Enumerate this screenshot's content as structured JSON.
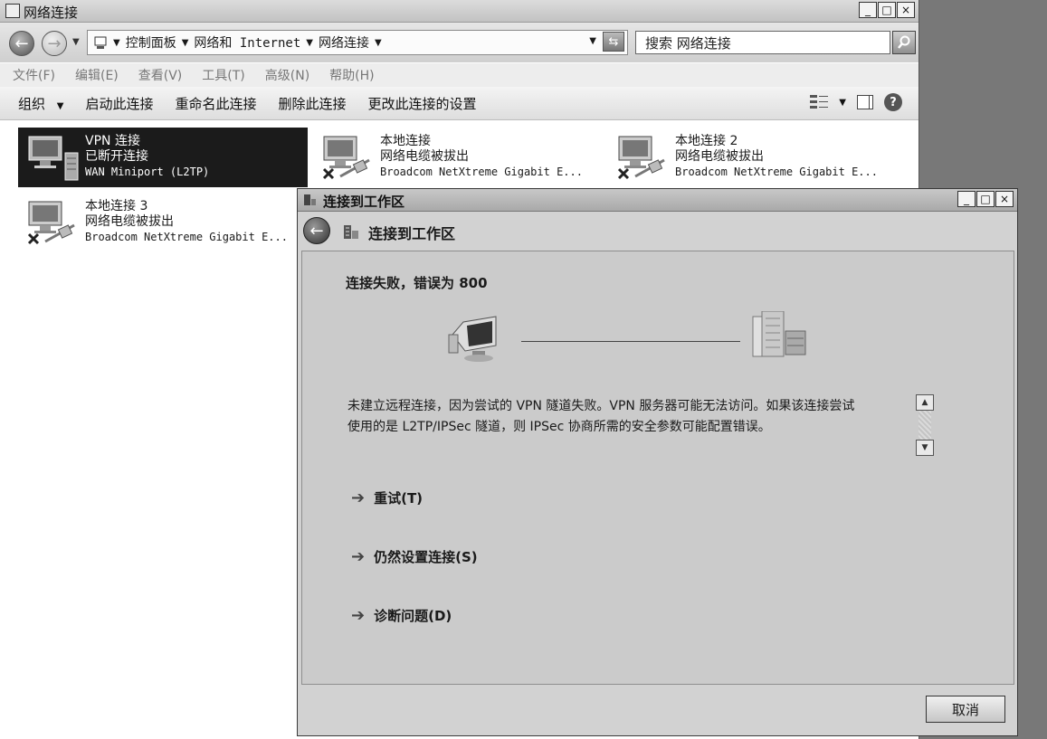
{
  "explorer": {
    "title": "网络连接",
    "window_buttons": [
      "_",
      "□",
      "×"
    ],
    "address": {
      "crumbs": [
        "控制面板",
        "网络和 Internet",
        "网络连接"
      ],
      "search_placeholder": "搜索 网络连接"
    },
    "menu": [
      "文件(F)",
      "编辑(E)",
      "查看(V)",
      "工具(T)",
      "高级(N)",
      "帮助(H)"
    ],
    "commands": {
      "organize": "组织",
      "start": "启动此连接",
      "rename": "重命名此连接",
      "delete": "删除此连接",
      "change_settings": "更改此连接的设置",
      "help": "?"
    },
    "connections": [
      {
        "name": "VPN 连接",
        "status": "已断开连接",
        "device": "WAN Miniport (L2TP)",
        "icon": "vpn-server-icon"
      },
      {
        "name": "本地连接",
        "status": "网络电缆被拔出",
        "device": "Broadcom NetXtreme Gigabit E...",
        "icon": "lan-disconnected-icon"
      },
      {
        "name": "本地连接 2",
        "status": "网络电缆被拔出",
        "device": "Broadcom NetXtreme Gigabit E...",
        "icon": "lan-disconnected-icon"
      },
      {
        "name": "本地连接 3",
        "status": "网络电缆被拔出",
        "device": "Broadcom NetXtreme Gigabit E...",
        "icon": "lan-disconnected-icon"
      }
    ]
  },
  "dialog": {
    "title": "连接到工作区",
    "header": "连接到工作区",
    "error_title": "连接失败，错误为 800",
    "message_lines": [
      "未建立远程连接，因为尝试的 VPN 隧道失败。VPN 服务器可能无法访问。如果该连接尝试",
      "使用的是 L2TP/IPSec 隧道，则 IPSec 协商所需的安全参数可能配置错误。"
    ],
    "actions": [
      "重试(T)",
      "仍然设置连接(S)",
      "诊断问题(D)"
    ],
    "cancel": "取消"
  },
  "colors": {
    "selection": "#1b1b1b",
    "desktop": "#787878",
    "dialog_bg": "#d2d2d2"
  }
}
